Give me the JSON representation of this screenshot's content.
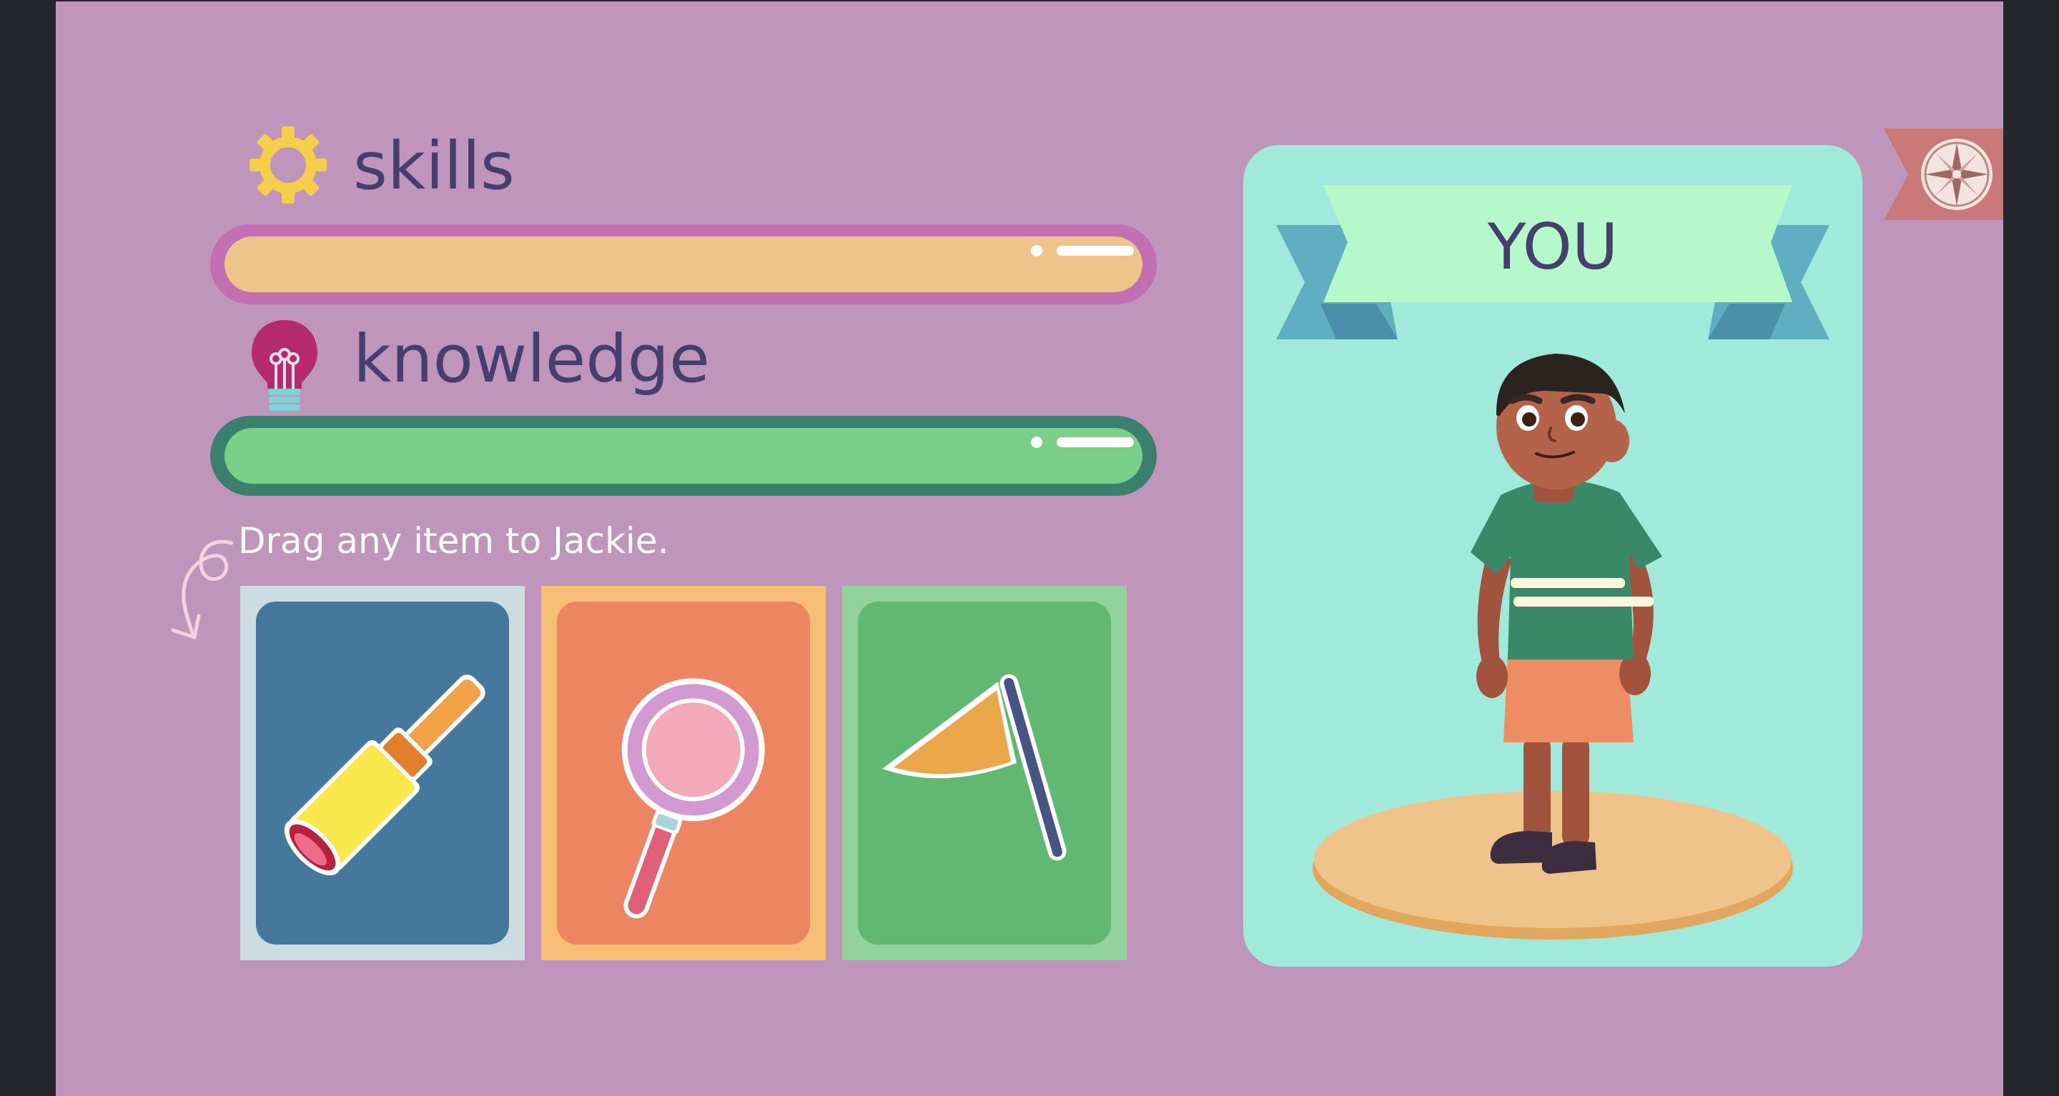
{
  "stats": {
    "skills": {
      "label": "skills",
      "icon": "gear-icon",
      "color": "#f5cf4a"
    },
    "knowledge": {
      "label": "knowledge",
      "icon": "lightbulb-icon",
      "color": "#b5296e"
    }
  },
  "bars": {
    "skills": {
      "outline_color": "#c26fb4",
      "fill_color": "#efc48a"
    },
    "knowledge": {
      "outline_color": "#3b7f6f",
      "fill_color": "#7bcf89"
    }
  },
  "instruction": "Drag any item to Jackie.",
  "items": [
    {
      "name": "telescope",
      "icon": "telescope-icon",
      "back_color": "#ccdde2",
      "front_color": "#44789c"
    },
    {
      "name": "magnifying-glass",
      "icon": "magnifying-glass-icon",
      "back_color": "#f7bf75",
      "front_color": "#ee8562"
    },
    {
      "name": "flag",
      "icon": "flag-icon",
      "back_color": "#91d39a",
      "front_color": "#60b872"
    }
  ],
  "character_card": {
    "banner_text": "YOU",
    "card_color": "#a1eadb",
    "banner_color": "#b5f8ca",
    "ribbon_color": "#5fafc1"
  },
  "compass_button": {
    "icon": "compass-icon",
    "color": "#c97a78"
  }
}
